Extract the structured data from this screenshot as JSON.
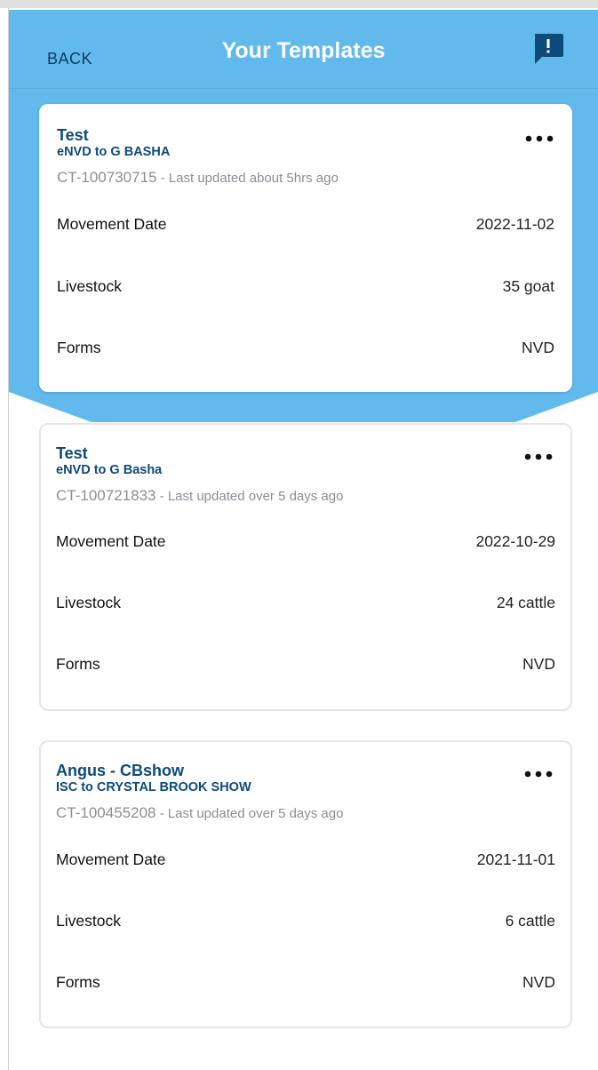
{
  "header": {
    "back_label": "BACK",
    "title": "Your Templates",
    "feedback_icon": "feedback-icon"
  },
  "colors": {
    "header_blue": "#62b9eb",
    "title_text": "#ffffff",
    "back_text": "#0d3b66",
    "card_title": "#0d4a7a",
    "meta_text": "#8a8f94"
  },
  "templates": [
    {
      "name": "Test",
      "subtitle": "eNVD to G BASHA",
      "id": "CT-100730715",
      "updated": " - Last updated about 5hrs ago",
      "rows": [
        {
          "label": "Movement Date",
          "value": "2022-11-02"
        },
        {
          "label": "Livestock",
          "value": "35 goat"
        },
        {
          "label": "Forms",
          "value": "NVD"
        }
      ]
    },
    {
      "name": "Test",
      "subtitle": "eNVD to G Basha",
      "id": "CT-100721833",
      "updated": " - Last updated over 5 days ago",
      "rows": [
        {
          "label": "Movement Date",
          "value": "2022-10-29"
        },
        {
          "label": "Livestock",
          "value": "24 cattle"
        },
        {
          "label": "Forms",
          "value": "NVD"
        }
      ]
    },
    {
      "name": "Angus - CBshow",
      "subtitle": "ISC to CRYSTAL BROOK SHOW",
      "id": "CT-100455208",
      "updated": " - Last updated over 5 days ago",
      "rows": [
        {
          "label": "Movement Date",
          "value": "2021-11-01"
        },
        {
          "label": "Livestock",
          "value": "6 cattle"
        },
        {
          "label": "Forms",
          "value": "NVD"
        }
      ]
    }
  ]
}
